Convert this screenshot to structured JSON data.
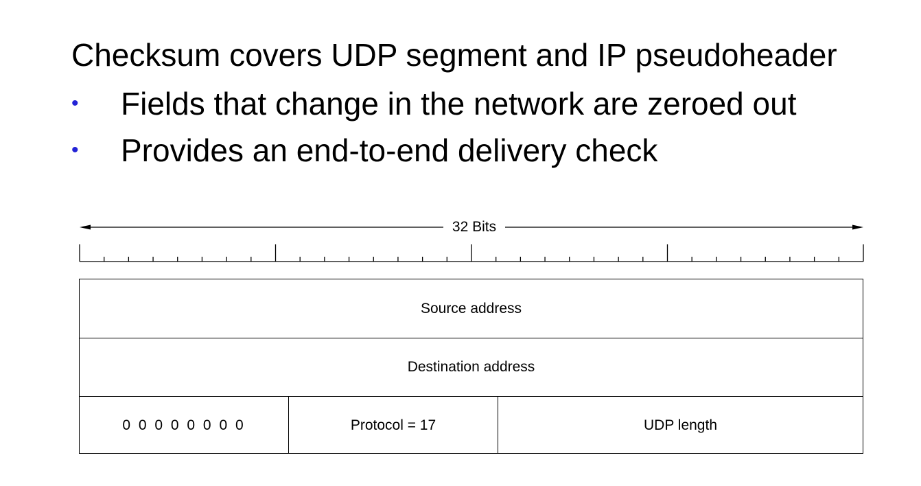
{
  "heading": "Checksum covers UDP segment and IP pseudoheader",
  "bullets": [
    {
      "marker": "•",
      "text": "Fields that change in the network are zeroed out"
    },
    {
      "marker": "•",
      "text": "Provides an end-to-end delivery check"
    }
  ],
  "colors": {
    "bullet": "#2323d6",
    "line": "#000000"
  },
  "diagram": {
    "width_label": "32 Bits",
    "bit_count": 32,
    "major_tick_every": 8,
    "rows": [
      {
        "cells": [
          {
            "label": "Source address",
            "bits": 32
          }
        ]
      },
      {
        "cells": [
          {
            "label": "Destination address",
            "bits": 32
          }
        ]
      },
      {
        "cells": [
          {
            "label": "0 0 0 0 0 0 0 0",
            "bits": 8
          },
          {
            "label": "Protocol = 17",
            "bits": 8
          },
          {
            "label": "UDP length",
            "bits": 16
          }
        ]
      }
    ]
  }
}
